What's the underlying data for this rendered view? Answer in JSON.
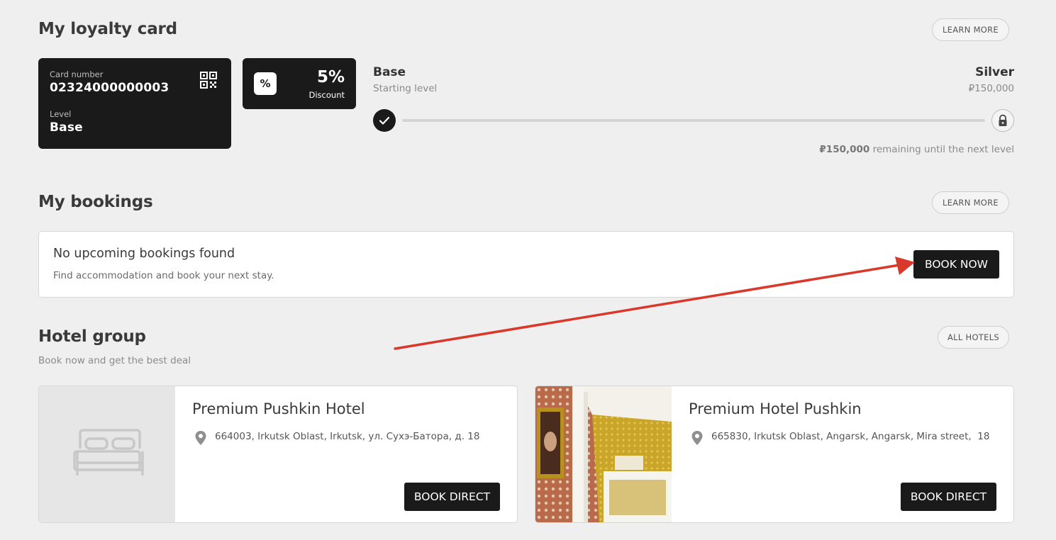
{
  "loyalty": {
    "title": "My loyalty card",
    "learn_more": "LEARN MORE",
    "card_number_label": "Card number",
    "card_number": "02324000000003",
    "level_label": "Level",
    "level": "Base",
    "discount_icon": "%",
    "discount_value": "5%",
    "discount_label": "Discount",
    "current_level_name": "Base",
    "current_level_sub": "Starting level",
    "next_level_name": "Silver",
    "next_level_threshold": "₽150,000",
    "progress_fraction": 0.0,
    "remaining_amount": "₽150,000",
    "remaining_text": " remaining until the next level"
  },
  "bookings": {
    "title": "My bookings",
    "learn_more": "LEARN MORE",
    "empty_title": "No upcoming bookings found",
    "empty_text": "Find accommodation and book your next stay.",
    "book_now": "BOOK NOW"
  },
  "hotels": {
    "title": "Hotel group",
    "subtitle": "Book now and get the best deal",
    "all_hotels": "ALL HOTELS",
    "items": [
      {
        "name": "Premium Pushkin Hotel",
        "address": "664003, Irkutsk Oblast, Irkutsk, ул. Сухэ-Батора, д. 18",
        "button": "BOOK DIRECT",
        "image": "bed-placeholder-icon"
      },
      {
        "name": "Premium Hotel Pushkin",
        "address": "665830, Irkutsk Oblast, Angarsk, Angarsk, Mira street,  18",
        "button": "BOOK DIRECT",
        "image": "hotel-interior-photo"
      }
    ]
  },
  "colors": {
    "dark": "#1a1a1a",
    "background": "#efefef",
    "annotation_arrow": "#d9392b"
  }
}
